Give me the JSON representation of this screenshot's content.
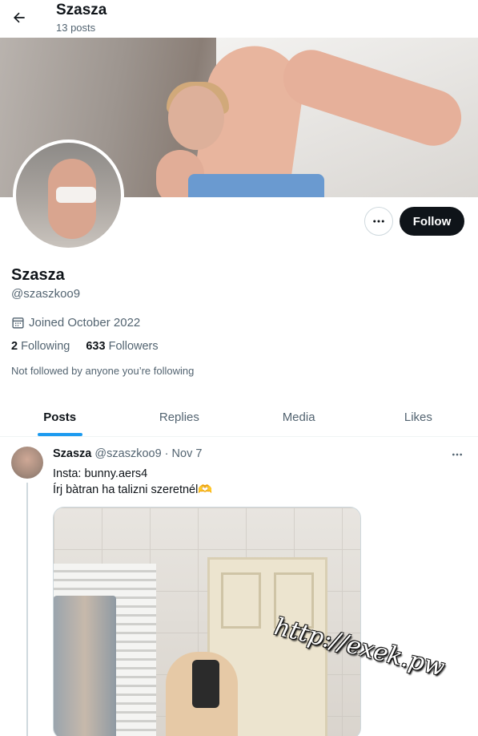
{
  "header": {
    "title": "Szasza",
    "post_count": "13 posts"
  },
  "profile": {
    "name": "Szasza",
    "handle": "@szaszkoo9",
    "joined": "Joined October 2022",
    "following_count": "2",
    "following_label": "Following",
    "followers_count": "633",
    "followers_label": "Followers",
    "not_followed_text": "Not followed by anyone you’re following",
    "follow_label": "Follow"
  },
  "tabs": [
    {
      "label": "Posts",
      "active": true
    },
    {
      "label": "Replies",
      "active": false
    },
    {
      "label": "Media",
      "active": false
    },
    {
      "label": "Likes",
      "active": false
    }
  ],
  "post": {
    "author_name": "Szasza",
    "author_handle": "@szaszkoo9",
    "separator": "·",
    "date": "Nov 7",
    "line1": "Insta: bunny.aers4",
    "line2": "Írj bàtran ha talizni szeretnél🫶"
  },
  "watermark": "http://exek.pw",
  "colors": {
    "accent": "#1d9bf0",
    "text_primary": "#0f1419",
    "text_secondary": "#536471",
    "follow_button_bg": "#0f1419"
  },
  "icons": {
    "back": "arrow-left-icon",
    "more": "ellipsis-icon",
    "calendar": "calendar-icon"
  }
}
